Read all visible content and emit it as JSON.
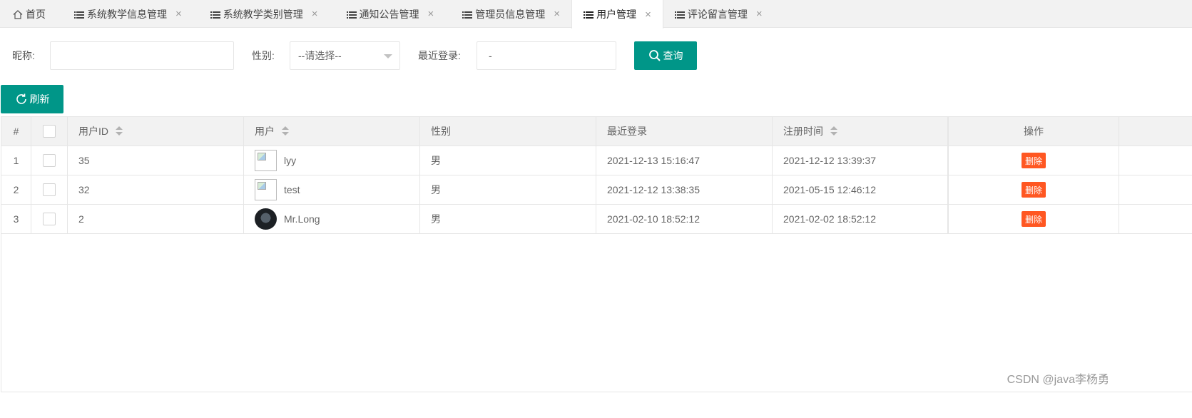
{
  "tabs": [
    {
      "label": "首页",
      "icon": "home-icon",
      "closable": false
    },
    {
      "label": "系统教学信息管理",
      "icon": "list-icon",
      "closable": true
    },
    {
      "label": "系统教学类别管理",
      "icon": "list-icon",
      "closable": true
    },
    {
      "label": "通知公告管理",
      "icon": "list-icon",
      "closable": true
    },
    {
      "label": "管理员信息管理",
      "icon": "list-icon",
      "closable": true
    },
    {
      "label": "用户管理",
      "icon": "list-icon",
      "closable": true,
      "active": true
    },
    {
      "label": "评论留言管理",
      "icon": "list-icon",
      "closable": true
    }
  ],
  "tab_close_glyph": "×",
  "search": {
    "nickname_label": "昵称:",
    "nickname_value": "",
    "gender_label": "性别:",
    "gender_selected": "--请选择--",
    "last_login_label": "最近登录:",
    "last_login_value": "-",
    "query_button": "查询"
  },
  "toolbar": {
    "refresh_button": "刷新"
  },
  "table": {
    "headers": [
      "#",
      "",
      "用户ID",
      "用户",
      "性别",
      "最近登录",
      "注册时间",
      "操作"
    ],
    "rows": [
      {
        "index": "1",
        "user_id": "35",
        "username": "lyy",
        "avatar": "broken",
        "gender": "男",
        "last_login": "2021-12-13 15:16:47",
        "registered": "2021-12-12 13:39:37",
        "action": "删除"
      },
      {
        "index": "2",
        "user_id": "32",
        "username": "test",
        "avatar": "broken",
        "gender": "男",
        "last_login": "2021-12-12 13:38:35",
        "registered": "2021-05-15 12:46:12",
        "action": "删除"
      },
      {
        "index": "3",
        "user_id": "2",
        "username": "Mr.Long",
        "avatar": "photo",
        "gender": "男",
        "last_login": "2021-02-10 18:52:12",
        "registered": "2021-02-02 18:52:12",
        "action": "删除"
      }
    ]
  },
  "watermark": "CSDN @java李杨勇",
  "colors": {
    "primary": "#009688",
    "danger": "#ff5722",
    "header_bg": "#f2f2f2"
  }
}
